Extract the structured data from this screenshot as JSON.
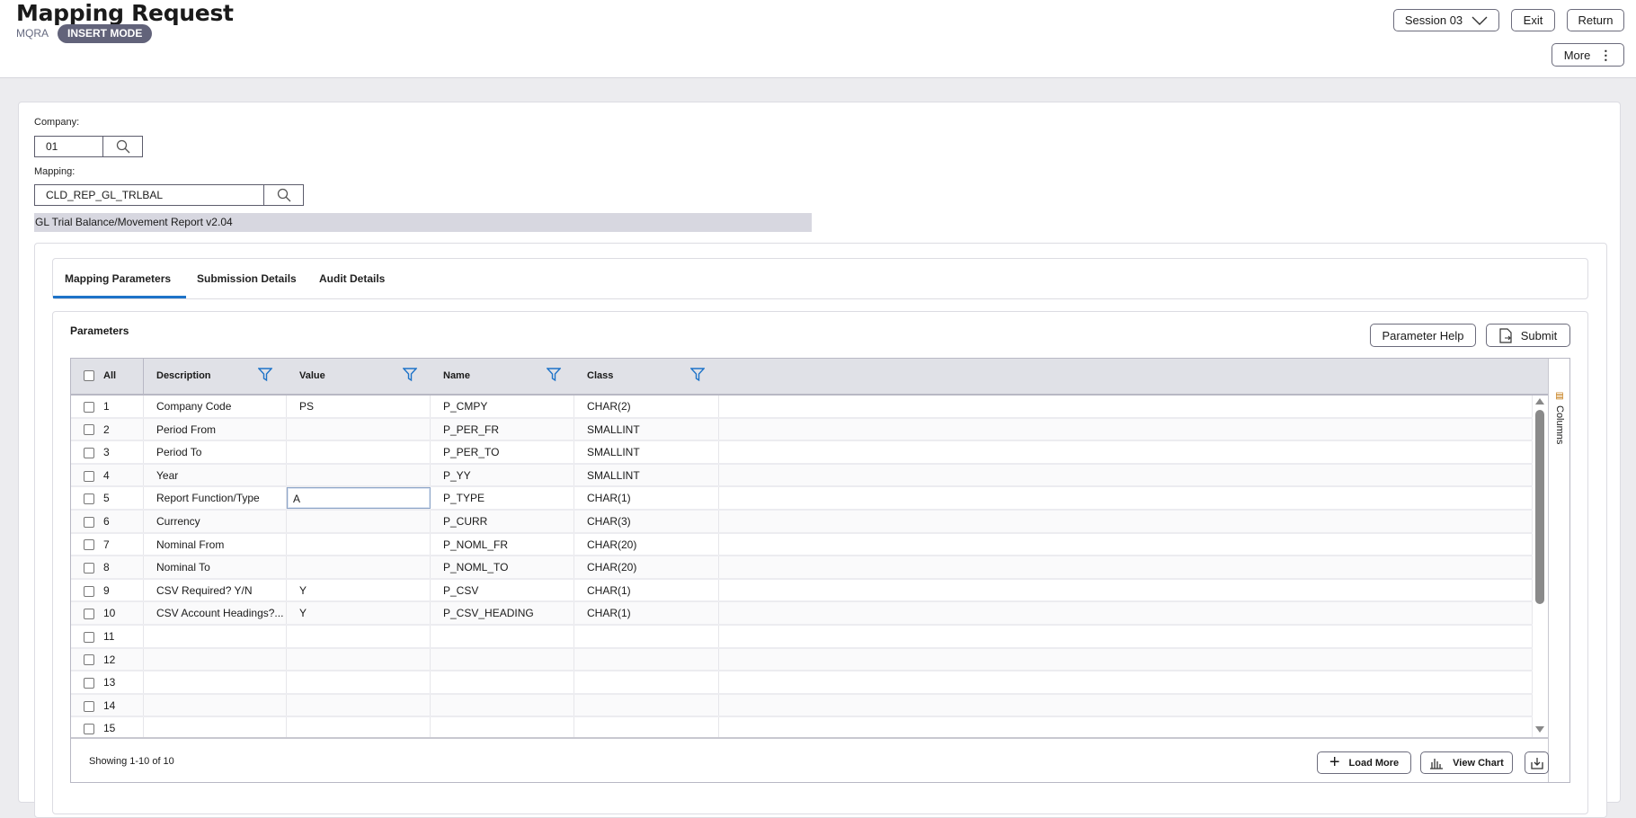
{
  "header": {
    "title": "Mapping Request",
    "code": "MQRA",
    "mode_badge": "INSERT MODE",
    "session_label": "Session 03",
    "exit_label": "Exit",
    "return_label": "Return",
    "more_label": "More"
  },
  "form": {
    "company_label": "Company:",
    "company_value": "01",
    "mapping_label": "Mapping:",
    "mapping_value": "CLD_REP_GL_TRLBAL",
    "mapping_description": "GL Trial Balance/Movement Report v2.04"
  },
  "tabs": [
    {
      "label": "Mapping Parameters",
      "active": true
    },
    {
      "label": "Submission Details",
      "active": false
    },
    {
      "label": "Audit Details",
      "active": false
    }
  ],
  "parameters": {
    "title": "Parameters",
    "help_label": "Parameter Help",
    "submit_label": "Submit",
    "columns": {
      "all": "All",
      "description": "Description",
      "value": "Value",
      "name": "Name",
      "class": "Class"
    },
    "rows": [
      {
        "n": "1",
        "description": "Company Code",
        "value": "PS",
        "name": "P_CMPY",
        "class": "CHAR(2)"
      },
      {
        "n": "2",
        "description": "Period From",
        "value": "",
        "name": "P_PER_FR",
        "class": "SMALLINT"
      },
      {
        "n": "3",
        "description": "Period To",
        "value": "",
        "name": "P_PER_TO",
        "class": "SMALLINT"
      },
      {
        "n": "4",
        "description": "Year",
        "value": "",
        "name": "P_YY",
        "class": "SMALLINT"
      },
      {
        "n": "5",
        "description": "Report Function/Type",
        "value": "A",
        "name": "P_TYPE",
        "class": "CHAR(1)"
      },
      {
        "n": "6",
        "description": "Currency",
        "value": "",
        "name": "P_CURR",
        "class": "CHAR(3)"
      },
      {
        "n": "7",
        "description": "Nominal From",
        "value": "",
        "name": "P_NOML_FR",
        "class": "CHAR(20)"
      },
      {
        "n": "8",
        "description": "Nominal To",
        "value": "",
        "name": "P_NOML_TO",
        "class": "CHAR(20)"
      },
      {
        "n": "9",
        "description": "CSV Required? Y/N",
        "value": "Y",
        "name": "P_CSV",
        "class": "CHAR(1)"
      },
      {
        "n": "10",
        "description": "CSV Account Headings?...",
        "value": "Y",
        "name": "P_CSV_HEADING",
        "class": "CHAR(1)"
      },
      {
        "n": "11",
        "description": "",
        "value": "",
        "name": "",
        "class": ""
      },
      {
        "n": "12",
        "description": "",
        "value": "",
        "name": "",
        "class": ""
      },
      {
        "n": "13",
        "description": "",
        "value": "",
        "name": "",
        "class": ""
      },
      {
        "n": "14",
        "description": "",
        "value": "",
        "name": "",
        "class": ""
      },
      {
        "n": "15",
        "description": "",
        "value": "",
        "name": "",
        "class": ""
      }
    ],
    "columns_panel_label": "Columns",
    "showing": "Showing 1-10 of 10",
    "load_more_label": "Load More",
    "view_chart_label": "View Chart"
  },
  "colors": {
    "accent": "#1e73c8",
    "badge": "#62637a"
  }
}
